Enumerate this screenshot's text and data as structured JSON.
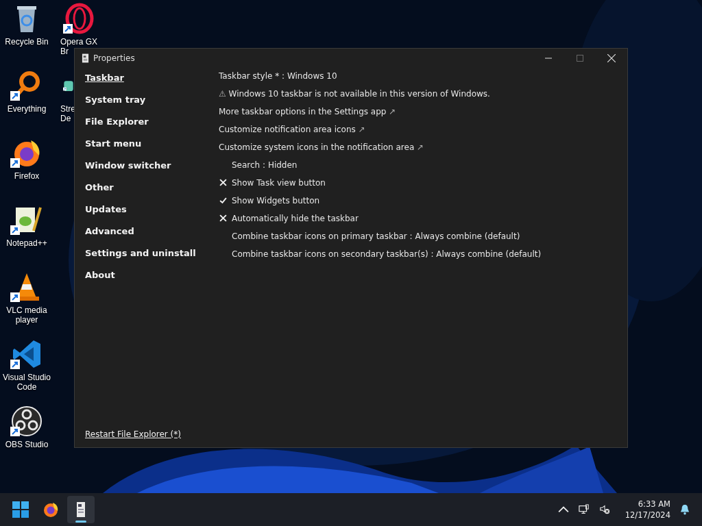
{
  "desktop_icons": [
    {
      "kind": "recycle",
      "label": [
        "Recycle Bin"
      ],
      "shortcut": false
    },
    {
      "kind": "search-ring",
      "label": [
        "Everything"
      ],
      "shortcut": true
    },
    {
      "kind": "firefox",
      "label": [
        "Firefox"
      ],
      "shortcut": true
    },
    {
      "kind": "notepad",
      "label": [
        "Notepad++"
      ],
      "shortcut": true
    },
    {
      "kind": "cone",
      "label": [
        "VLC media",
        "player"
      ],
      "shortcut": true
    },
    {
      "kind": "code",
      "label": [
        "Visual Studio",
        "Code"
      ],
      "shortcut": true
    },
    {
      "kind": "obs",
      "label": [
        "OBS Studio"
      ],
      "shortcut": true
    },
    {
      "kind": "ring",
      "label": [
        "Opera GX",
        "Br"
      ],
      "shortcut": true
    },
    {
      "kind": "deck",
      "label": [
        "Stre",
        "De"
      ],
      "shortcut": true
    }
  ],
  "window": {
    "title": "Properties",
    "sidebar": {
      "items": [
        {
          "label": "Taskbar",
          "selected": true
        },
        {
          "label": "System tray",
          "selected": false
        },
        {
          "label": "File Explorer",
          "selected": false
        },
        {
          "label": "Start menu",
          "selected": false
        },
        {
          "label": "Window switcher",
          "selected": false
        },
        {
          "label": "Other",
          "selected": false
        },
        {
          "label": "Updates",
          "selected": false
        },
        {
          "label": "Advanced",
          "selected": false
        },
        {
          "label": "Settings and uninstall",
          "selected": false
        },
        {
          "label": "About",
          "selected": false
        }
      ],
      "footer_link": "Restart File Explorer (*)"
    },
    "settings": [
      {
        "kind": "text",
        "label": "Taskbar style * : Windows 10"
      },
      {
        "kind": "warning",
        "icon": "⚠",
        "label": "Windows 10 taskbar is not available in this version of Windows."
      },
      {
        "kind": "link",
        "label": "More taskbar options in the Settings app",
        "arrow": "↗"
      },
      {
        "kind": "link",
        "label": "Customize notification area icons",
        "arrow": "↗"
      },
      {
        "kind": "link",
        "label": "Customize system icons in the notification area",
        "arrow": "↗"
      },
      {
        "kind": "choice",
        "label": "Search : Hidden"
      },
      {
        "kind": "toggle",
        "label": "Show Task view button",
        "checked": false
      },
      {
        "kind": "toggle",
        "label": "Show Widgets button",
        "checked": true
      },
      {
        "kind": "toggle",
        "label": "Automatically hide the taskbar",
        "checked": false
      },
      {
        "kind": "choice",
        "label": "Combine taskbar icons on primary taskbar : Always combine (default)"
      },
      {
        "kind": "choice",
        "label": "Combine taskbar icons on secondary taskbar(s) : Always combine (default)"
      }
    ]
  },
  "taskbar": {
    "apps": [
      {
        "kind": "start",
        "selected": false
      },
      {
        "kind": "firefox",
        "selected": false
      },
      {
        "kind": "document",
        "selected": true
      }
    ],
    "time": "6:33 AM",
    "date": "12/17/2024"
  }
}
